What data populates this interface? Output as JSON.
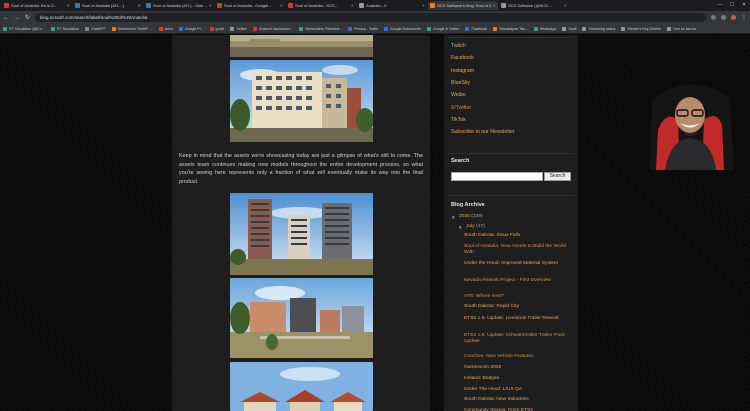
{
  "tabs": [
    {
      "label": "Soul of Anatolia: Bu is C...",
      "color": "#d33"
    },
    {
      "label": "Soul of Anatolia (ATL...)",
      "color": "#3a6ed8"
    },
    {
      "label": "Soul of Anatolia (ATL) - Sele ...",
      "color": "#3a6ed8"
    },
    {
      "label": "Soul of Anatolia - Google ...",
      "color": "#d33"
    },
    {
      "label": "Soul of Anatolia - SCS...",
      "color": "#d33"
    },
    {
      "label": "Anatolia - X",
      "color": "#999"
    },
    {
      "label": "SCS Software's blog: Soul of A...",
      "color": "#e77b2a"
    },
    {
      "label": "SCS Software (@SCS ...",
      "color": "#999"
    }
  ],
  "address": {
    "url": "blog.scssoft.com/search/label/Soul%20of%20Anatolia"
  },
  "bookmarks": [
    {
      "label": "ST Simulation (@Co...",
      "color": "#3a7"
    },
    {
      "label": "ST Simulation",
      "color": "#3a7"
    },
    {
      "label": "ChatGPT",
      "color": "#888"
    },
    {
      "label": "Steelseries \"SciKit\" ...",
      "color": "#e77b2a"
    },
    {
      "label": "Amst",
      "color": "#e33"
    },
    {
      "label": "Google Pl...",
      "color": "#3a6ed8"
    },
    {
      "label": "gmail",
      "color": "#d33"
    },
    {
      "label": "Twitter",
      "color": "#999"
    },
    {
      "label": "Channel dashboard...",
      "color": "#d33"
    },
    {
      "label": "Streamlabs: Rebrand...",
      "color": "#3a7"
    },
    {
      "label": "Privacy - Twilio",
      "color": "#3a6ed8"
    },
    {
      "label": "Google Dokumente",
      "color": "#3a6ed8"
    },
    {
      "label": "Google & Twitter",
      "color": "#3a7"
    },
    {
      "label": "Facebook",
      "color": "#3a6ed8"
    },
    {
      "label": "Streaklapse Tas...",
      "color": "#e77b2a"
    },
    {
      "label": "WhatsApp",
      "color": "#3a7"
    },
    {
      "label": "Scuff",
      "color": "#999"
    },
    {
      "label": "Streaming status",
      "color": "#999"
    },
    {
      "label": "Stealer's Key Dubble",
      "color": "#999"
    },
    {
      "label": "Tum ke karma",
      "color": "#999"
    }
  ],
  "post": {
    "paragraph": "Keep in mind that the assets we're showcasing today are just a glimpse of what's still to come. The assets team continues making new models throughout the entire development process, so what you're seeing here represents only a fraction of what will eventually make its way into the final product."
  },
  "sidebar": {
    "social_links": [
      "Twitch",
      "Facebook",
      "Instagram",
      "BlueSky",
      "Weibo",
      "X/Twitter",
      "TikTok",
      "Subscribe to our Newsletter"
    ],
    "search_title": "Search",
    "search_button": "Search",
    "archive_title": "Blog Archive",
    "archive_year": "2026",
    "archive_year_count": "(339)",
    "archive_month": "July",
    "archive_month_count": "(17)",
    "posts": [
      "South Dakota: Sioux Falls",
      "Soul of Anatolia: New Assets to Build the World With",
      "Under the Hood: Improved Material System",
      "Nevada Rework Project - First Overview",
      "ATS: Where next?",
      "South Dakota: Rapid City",
      "ETS2 1.6: Update: Livestock Trailer Rework",
      "ETS2 1.6: Update: Schwarzmüller Trailer Pack Update",
      "Coaches: New Vehicle Features",
      "Gamescom 2026",
      "Iceland: Bridges",
      "Under The Hood: L/UX QA",
      "South Dakota: New Industries",
      "Community Stories: From ETS2"
    ]
  }
}
